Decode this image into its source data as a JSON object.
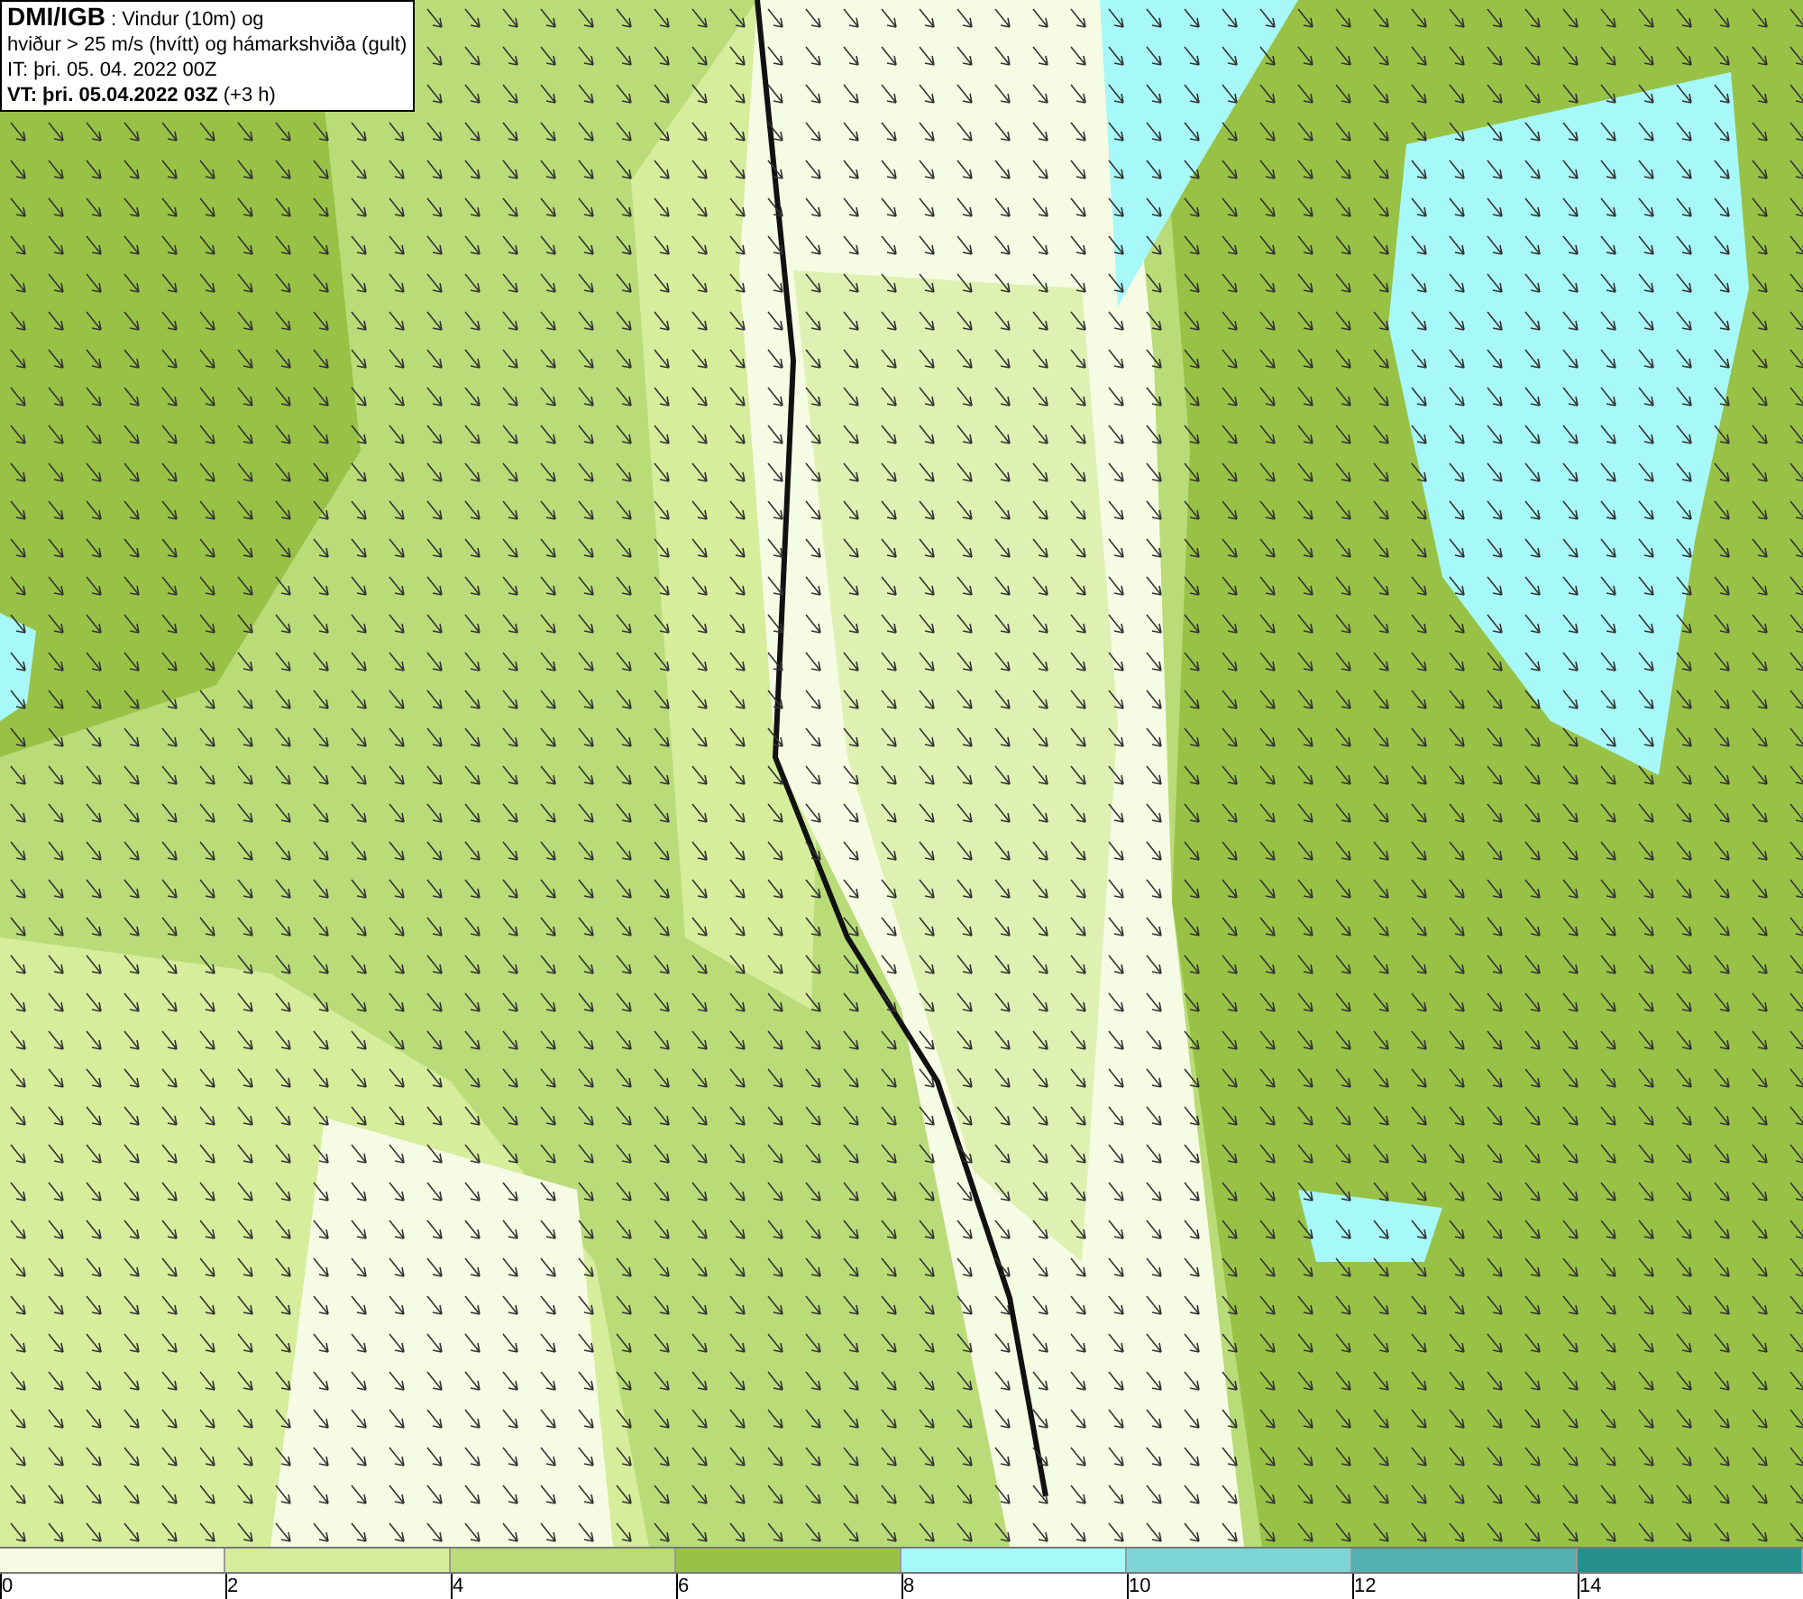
{
  "header": {
    "source": "DMI/IGB",
    "title": ": Vindur (10m) og",
    "subtitle": "hviður > 25 m/s (hvítt) og hámarkshviða (gult)",
    "initial_time": "IT: þri. 05. 04. 2022 00Z",
    "valid_time": "VT: þri. 05.04.2022 03Z",
    "offset": "(+3 h)"
  },
  "legend": {
    "segments": [
      {
        "color": "#f6fbe4"
      },
      {
        "color": "#d6ed9c"
      },
      {
        "color": "#b9dc79"
      },
      {
        "color": "#98c246"
      },
      {
        "color": "#a7f8f8"
      },
      {
        "color": "#7dd5d5"
      },
      {
        "color": "#53b1b1"
      },
      {
        "color": "#248f8c"
      }
    ],
    "ticks": [
      "0",
      "2",
      "4",
      "6",
      "8",
      "10",
      "12",
      "14"
    ]
  }
}
